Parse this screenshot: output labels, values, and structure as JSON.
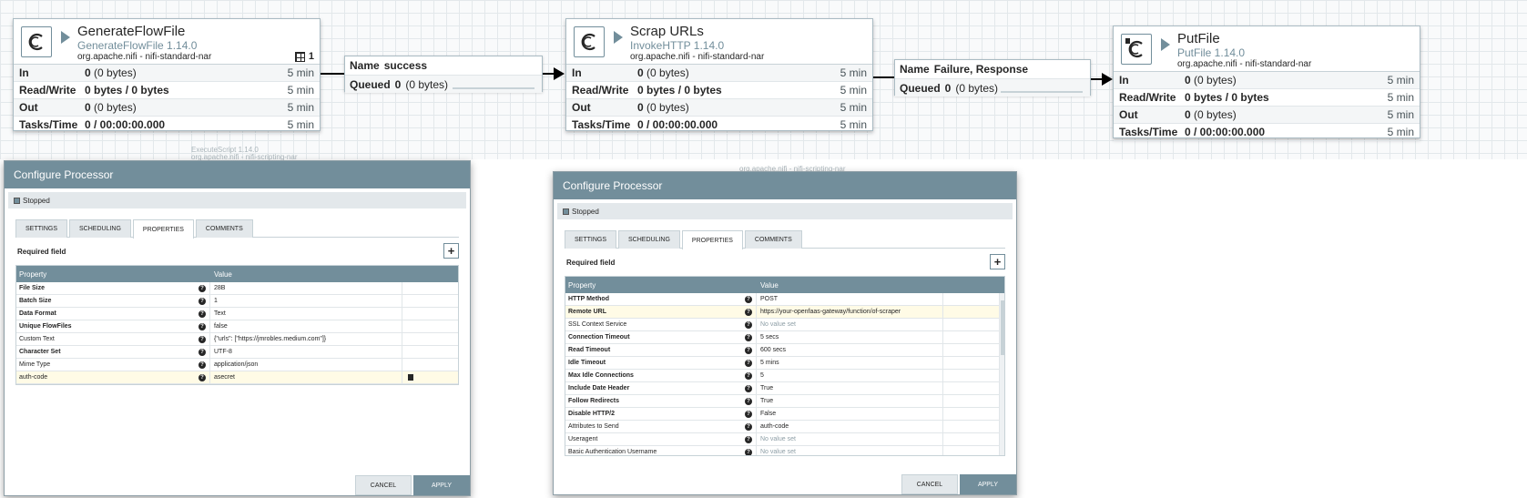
{
  "processors": [
    {
      "name": "GenerateFlowFile",
      "type": "GenerateFlowFile 1.14.0",
      "bundle": "org.apache.nifi - nifi-standard-nar",
      "badge": "1",
      "stats": [
        {
          "label": "In",
          "value_bold": "0",
          "value": "(0 bytes)",
          "time": "5 min"
        },
        {
          "label": "Read/Write",
          "value_bold": "0 bytes / 0 bytes",
          "value": "",
          "time": "5 min"
        },
        {
          "label": "Out",
          "value_bold": "0",
          "value": "(0 bytes)",
          "time": "5 min"
        },
        {
          "label": "Tasks/Time",
          "value_bold": "0 / 00:00:00.000",
          "value": "",
          "time": "5 min"
        }
      ]
    },
    {
      "name": "Scrap URLs",
      "type": "InvokeHTTP 1.14.0",
      "bundle": "org.apache.nifi - nifi-standard-nar",
      "stats": [
        {
          "label": "In",
          "value_bold": "0",
          "value": "(0 bytes)",
          "time": "5 min"
        },
        {
          "label": "Read/Write",
          "value_bold": "0 bytes / 0 bytes",
          "value": "",
          "time": "5 min"
        },
        {
          "label": "Out",
          "value_bold": "0",
          "value": "(0 bytes)",
          "time": "5 min"
        },
        {
          "label": "Tasks/Time",
          "value_bold": "0 / 00:00:00.000",
          "value": "",
          "time": "5 min"
        }
      ]
    },
    {
      "name": "PutFile",
      "type": "PutFile 1.14.0",
      "bundle": "org.apache.nifi - nifi-standard-nar",
      "stats": [
        {
          "label": "In",
          "value_bold": "0",
          "value": "(0 bytes)",
          "time": "5 min"
        },
        {
          "label": "Read/Write",
          "value_bold": "0 bytes / 0 bytes",
          "value": "",
          "time": "5 min"
        },
        {
          "label": "Out",
          "value_bold": "0",
          "value": "(0 bytes)",
          "time": "5 min"
        },
        {
          "label": "Tasks/Time",
          "value_bold": "0 / 00:00:00.000",
          "value": "",
          "time": "5 min"
        }
      ]
    }
  ],
  "connections": [
    {
      "name_label": "Name",
      "name": "success",
      "queued_label": "Queued",
      "queued_bold": "0",
      "queued": "(0 bytes)"
    },
    {
      "name_label": "Name",
      "name": "Failure, Response",
      "queued_label": "Queued",
      "queued_bold": "0",
      "queued": "(0 bytes)"
    }
  ],
  "ghost": {
    "left_name": "ExecuteScript 1.14.0",
    "left_bundle": "org.apache.nifi - nifi-scripting-nar",
    "mid_bundle": "org.apache.nifi - nifi-scripting-nar"
  },
  "dialog_common": {
    "title": "Configure Processor",
    "status": "Stopped",
    "tabs": [
      "SETTINGS",
      "SCHEDULING",
      "PROPERTIES",
      "COMMENTS"
    ],
    "required_field": "Required field",
    "add_symbol": "+",
    "col_property": "Property",
    "col_value": "Value",
    "help_symbol": "?",
    "cancel": "CANCEL",
    "apply": "APPLY"
  },
  "dialog_left": {
    "properties": [
      {
        "name": "File Size",
        "value": "28B",
        "required": true
      },
      {
        "name": "Batch Size",
        "value": "1",
        "required": true
      },
      {
        "name": "Data Format",
        "value": "Text",
        "required": true
      },
      {
        "name": "Unique FlowFiles",
        "value": "false",
        "required": true
      },
      {
        "name": "Custom Text",
        "value": "{\"urls\": [\"https://jmrobles.medium.com\"]}",
        "required": false
      },
      {
        "name": "Character Set",
        "value": "UTF-8",
        "required": true
      },
      {
        "name": "Mime Type",
        "value": "application/json",
        "required": false
      },
      {
        "name": "auth-code",
        "value": "asecret",
        "required": false,
        "highlight": true,
        "deletable": true
      }
    ]
  },
  "dialog_right": {
    "properties": [
      {
        "name": "HTTP Method",
        "value": "POST",
        "required": true
      },
      {
        "name": "Remote URL",
        "value": "https://your-openfaas-gateway/function/of-scraper",
        "required": true,
        "highlight": true
      },
      {
        "name": "SSL Context Service",
        "value": "No value set",
        "required": false,
        "unset": true
      },
      {
        "name": "Connection Timeout",
        "value": "5 secs",
        "required": true
      },
      {
        "name": "Read Timeout",
        "value": "600 secs",
        "required": true
      },
      {
        "name": "Idle Timeout",
        "value": "5 mins",
        "required": true
      },
      {
        "name": "Max Idle Connections",
        "value": "5",
        "required": true
      },
      {
        "name": "Include Date Header",
        "value": "True",
        "required": true
      },
      {
        "name": "Follow Redirects",
        "value": "True",
        "required": true
      },
      {
        "name": "Disable HTTP/2",
        "value": "False",
        "required": true
      },
      {
        "name": "Attributes to Send",
        "value": "auth-code",
        "required": false
      },
      {
        "name": "Useragent",
        "value": "No value set",
        "required": false,
        "unset": true
      },
      {
        "name": "Basic Authentication Username",
        "value": "No value set",
        "required": false,
        "unset": true
      }
    ]
  }
}
